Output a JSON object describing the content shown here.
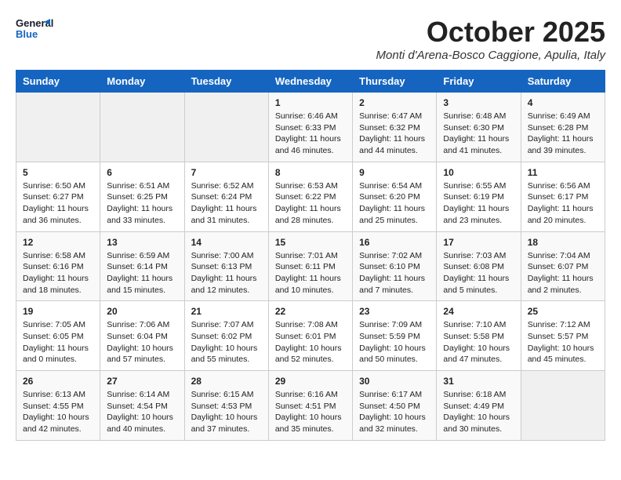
{
  "header": {
    "logo_general": "General",
    "logo_blue": "Blue",
    "month": "October 2025",
    "location": "Monti d'Arena-Bosco Caggione, Apulia, Italy"
  },
  "days_of_week": [
    "Sunday",
    "Monday",
    "Tuesday",
    "Wednesday",
    "Thursday",
    "Friday",
    "Saturday"
  ],
  "weeks": [
    [
      {
        "day": "",
        "info": ""
      },
      {
        "day": "",
        "info": ""
      },
      {
        "day": "",
        "info": ""
      },
      {
        "day": "1",
        "info": "Sunrise: 6:46 AM\nSunset: 6:33 PM\nDaylight: 11 hours and 46 minutes."
      },
      {
        "day": "2",
        "info": "Sunrise: 6:47 AM\nSunset: 6:32 PM\nDaylight: 11 hours and 44 minutes."
      },
      {
        "day": "3",
        "info": "Sunrise: 6:48 AM\nSunset: 6:30 PM\nDaylight: 11 hours and 41 minutes."
      },
      {
        "day": "4",
        "info": "Sunrise: 6:49 AM\nSunset: 6:28 PM\nDaylight: 11 hours and 39 minutes."
      }
    ],
    [
      {
        "day": "5",
        "info": "Sunrise: 6:50 AM\nSunset: 6:27 PM\nDaylight: 11 hours and 36 minutes."
      },
      {
        "day": "6",
        "info": "Sunrise: 6:51 AM\nSunset: 6:25 PM\nDaylight: 11 hours and 33 minutes."
      },
      {
        "day": "7",
        "info": "Sunrise: 6:52 AM\nSunset: 6:24 PM\nDaylight: 11 hours and 31 minutes."
      },
      {
        "day": "8",
        "info": "Sunrise: 6:53 AM\nSunset: 6:22 PM\nDaylight: 11 hours and 28 minutes."
      },
      {
        "day": "9",
        "info": "Sunrise: 6:54 AM\nSunset: 6:20 PM\nDaylight: 11 hours and 25 minutes."
      },
      {
        "day": "10",
        "info": "Sunrise: 6:55 AM\nSunset: 6:19 PM\nDaylight: 11 hours and 23 minutes."
      },
      {
        "day": "11",
        "info": "Sunrise: 6:56 AM\nSunset: 6:17 PM\nDaylight: 11 hours and 20 minutes."
      }
    ],
    [
      {
        "day": "12",
        "info": "Sunrise: 6:58 AM\nSunset: 6:16 PM\nDaylight: 11 hours and 18 minutes."
      },
      {
        "day": "13",
        "info": "Sunrise: 6:59 AM\nSunset: 6:14 PM\nDaylight: 11 hours and 15 minutes."
      },
      {
        "day": "14",
        "info": "Sunrise: 7:00 AM\nSunset: 6:13 PM\nDaylight: 11 hours and 12 minutes."
      },
      {
        "day": "15",
        "info": "Sunrise: 7:01 AM\nSunset: 6:11 PM\nDaylight: 11 hours and 10 minutes."
      },
      {
        "day": "16",
        "info": "Sunrise: 7:02 AM\nSunset: 6:10 PM\nDaylight: 11 hours and 7 minutes."
      },
      {
        "day": "17",
        "info": "Sunrise: 7:03 AM\nSunset: 6:08 PM\nDaylight: 11 hours and 5 minutes."
      },
      {
        "day": "18",
        "info": "Sunrise: 7:04 AM\nSunset: 6:07 PM\nDaylight: 11 hours and 2 minutes."
      }
    ],
    [
      {
        "day": "19",
        "info": "Sunrise: 7:05 AM\nSunset: 6:05 PM\nDaylight: 11 hours and 0 minutes."
      },
      {
        "day": "20",
        "info": "Sunrise: 7:06 AM\nSunset: 6:04 PM\nDaylight: 10 hours and 57 minutes."
      },
      {
        "day": "21",
        "info": "Sunrise: 7:07 AM\nSunset: 6:02 PM\nDaylight: 10 hours and 55 minutes."
      },
      {
        "day": "22",
        "info": "Sunrise: 7:08 AM\nSunset: 6:01 PM\nDaylight: 10 hours and 52 minutes."
      },
      {
        "day": "23",
        "info": "Sunrise: 7:09 AM\nSunset: 5:59 PM\nDaylight: 10 hours and 50 minutes."
      },
      {
        "day": "24",
        "info": "Sunrise: 7:10 AM\nSunset: 5:58 PM\nDaylight: 10 hours and 47 minutes."
      },
      {
        "day": "25",
        "info": "Sunrise: 7:12 AM\nSunset: 5:57 PM\nDaylight: 10 hours and 45 minutes."
      }
    ],
    [
      {
        "day": "26",
        "info": "Sunrise: 6:13 AM\nSunset: 4:55 PM\nDaylight: 10 hours and 42 minutes."
      },
      {
        "day": "27",
        "info": "Sunrise: 6:14 AM\nSunset: 4:54 PM\nDaylight: 10 hours and 40 minutes."
      },
      {
        "day": "28",
        "info": "Sunrise: 6:15 AM\nSunset: 4:53 PM\nDaylight: 10 hours and 37 minutes."
      },
      {
        "day": "29",
        "info": "Sunrise: 6:16 AM\nSunset: 4:51 PM\nDaylight: 10 hours and 35 minutes."
      },
      {
        "day": "30",
        "info": "Sunrise: 6:17 AM\nSunset: 4:50 PM\nDaylight: 10 hours and 32 minutes."
      },
      {
        "day": "31",
        "info": "Sunrise: 6:18 AM\nSunset: 4:49 PM\nDaylight: 10 hours and 30 minutes."
      },
      {
        "day": "",
        "info": ""
      }
    ]
  ]
}
